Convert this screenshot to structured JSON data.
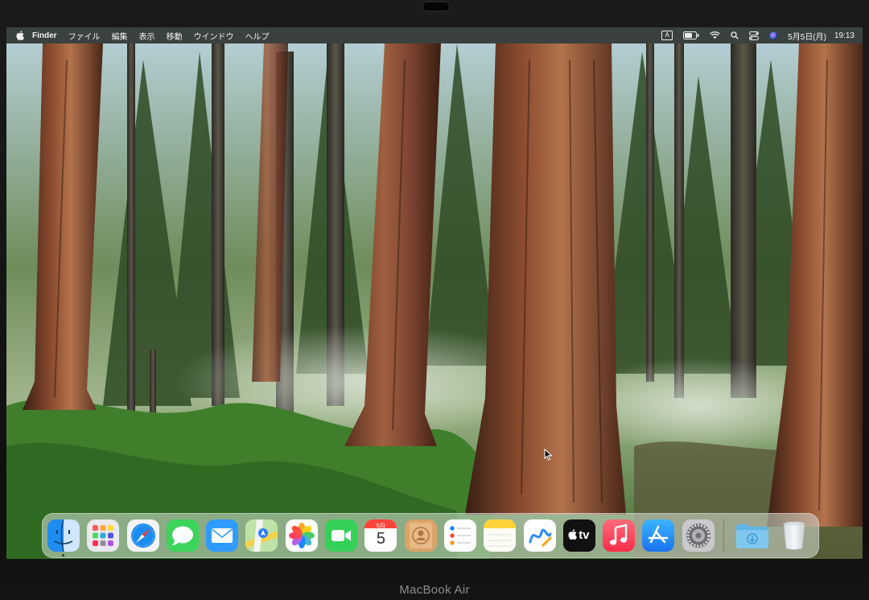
{
  "menubar": {
    "app_name": "Finder",
    "items": [
      "ファイル",
      "編集",
      "表示",
      "移動",
      "ウインドウ",
      "ヘルプ"
    ],
    "input_mode": "A",
    "date": "5月5日(月)",
    "time": "19:13"
  },
  "dock": {
    "apps": [
      {
        "name": "finder",
        "icon": "finder-icon",
        "running": true
      },
      {
        "name": "launchpad",
        "icon": "launchpad-icon",
        "running": false
      },
      {
        "name": "safari",
        "icon": "safari-icon",
        "running": false
      },
      {
        "name": "messages",
        "icon": "messages-icon",
        "running": false
      },
      {
        "name": "mail",
        "icon": "mail-icon",
        "running": false
      },
      {
        "name": "maps",
        "icon": "maps-icon",
        "running": false
      },
      {
        "name": "photos",
        "icon": "photos-icon",
        "running": false
      },
      {
        "name": "facetime",
        "icon": "facetime-icon",
        "running": false
      },
      {
        "name": "calendar",
        "icon": "calendar-icon",
        "running": false
      },
      {
        "name": "contacts",
        "icon": "contacts-icon",
        "running": false
      },
      {
        "name": "reminders",
        "icon": "reminders-icon",
        "running": false
      },
      {
        "name": "notes",
        "icon": "notes-icon",
        "running": false
      },
      {
        "name": "freeform",
        "icon": "freeform-icon",
        "running": false
      },
      {
        "name": "apple-tv",
        "icon": "apple-tv-icon",
        "running": false
      },
      {
        "name": "music",
        "icon": "music-icon",
        "running": false
      },
      {
        "name": "app-store",
        "icon": "app-store-icon",
        "running": false
      },
      {
        "name": "system-settings",
        "icon": "gear-icon",
        "running": false
      },
      {
        "name": "downloads",
        "icon": "download-folder-icon",
        "running": false
      },
      {
        "name": "trash",
        "icon": "trash-icon",
        "running": false
      }
    ],
    "calendar": {
      "month": "5月",
      "day": "5"
    },
    "tv_label": "tv"
  },
  "device": {
    "label": "MacBook Air"
  }
}
